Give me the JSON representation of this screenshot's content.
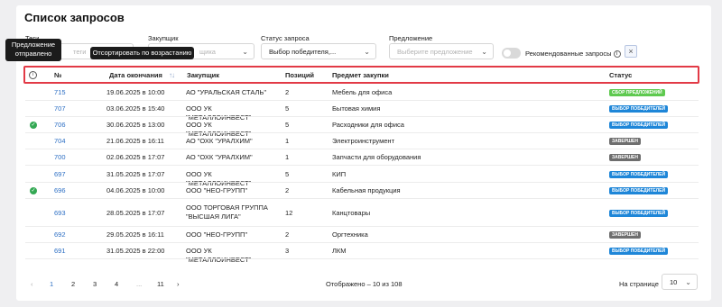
{
  "page": {
    "title": "Список запросов"
  },
  "filters": {
    "tags": {
      "label": "Теги",
      "placeholder": "теги"
    },
    "buyer": {
      "label": "Закупщик",
      "placeholder": "щика"
    },
    "status": {
      "label": "Статус запроса",
      "value": "Выбор победителя,..."
    },
    "offer": {
      "label": "Предложение",
      "placeholder": "Выберите предложение"
    },
    "recommended_label": "Рекомендованные запросы",
    "clear": "×"
  },
  "tooltips": {
    "offer_sent": "Предложение отправлено",
    "sort_asc": "Отсортировать по возрастанию"
  },
  "table": {
    "headers": {
      "num": "№",
      "end_date": "Дата окончания",
      "buyer": "Закупщик",
      "positions": "Позиций",
      "subject": "Предмет закупки",
      "status": "Статус"
    },
    "rows": [
      {
        "offer_sent": false,
        "num": "715",
        "end_date": "19.06.2025 в 10:00",
        "buyer": "АО \"УРАЛЬСКАЯ СТАЛЬ\"",
        "positions": "2",
        "subject": "Мебель для офиса",
        "status": "СБОР ПРЕДЛОЖЕНИЙ",
        "status_color": "#5ec94f"
      },
      {
        "offer_sent": false,
        "num": "707",
        "end_date": "03.06.2025 в 15:40",
        "buyer": "ООО УК \"МЕТАЛЛОИНВЕСТ\"",
        "positions": "5",
        "subject": "Бытовая химия",
        "status": "ВЫБОР ПОБЕДИТЕЛЕЙ",
        "status_color": "#1e86d8"
      },
      {
        "offer_sent": true,
        "num": "706",
        "end_date": "30.06.2025 в 13:00",
        "buyer": "ООО УК \"МЕТАЛЛОИНВЕСТ\"",
        "positions": "5",
        "subject": "Расходники для офиса",
        "status": "ВЫБОР ПОБЕДИТЕЛЕЙ",
        "status_color": "#1e86d8"
      },
      {
        "offer_sent": false,
        "num": "704",
        "end_date": "21.06.2025 в 16:11",
        "buyer": "АО \"ОХК \"УРАЛХИМ\"",
        "positions": "1",
        "subject": "Электроинструмент",
        "status": "ЗАВЕРШЕН",
        "status_color": "#6e6e6e"
      },
      {
        "offer_sent": false,
        "num": "700",
        "end_date": "02.06.2025 в 17:07",
        "buyer": "АО \"ОХК \"УРАЛХИМ\"",
        "positions": "1",
        "subject": "Запчасти для оборудования",
        "status": "ЗАВЕРШЕН",
        "status_color": "#6e6e6e"
      },
      {
        "offer_sent": false,
        "num": "697",
        "end_date": "31.05.2025 в 17:07",
        "buyer": "ООО УК \"МЕТАЛЛОИНВЕСТ\"",
        "positions": "5",
        "subject": "КИП",
        "status": "ВЫБОР ПОБЕДИТЕЛЕЙ",
        "status_color": "#1e86d8"
      },
      {
        "offer_sent": true,
        "num": "696",
        "end_date": "04.06.2025 в 10:00",
        "buyer": "ООО \"НЕО-ГРУПП\"",
        "positions": "2",
        "subject": "Кабельная продукция",
        "status": "ВЫБОР ПОБЕДИТЕЛЕЙ",
        "status_color": "#1e86d8"
      },
      {
        "offer_sent": false,
        "num": "693",
        "end_date": "28.05.2025 в 17:07",
        "buyer": "ООО ТОРГОВАЯ ГРУППА \"ВЫСШАЯ ЛИГА\"",
        "positions": "12",
        "subject": "Канцтовары",
        "status": "ВЫБОР ПОБЕДИТЕЛЕЙ",
        "status_color": "#1e86d8"
      },
      {
        "offer_sent": false,
        "num": "692",
        "end_date": "29.05.2025 в 16:11",
        "buyer": "ООО \"НЕО-ГРУПП\"",
        "positions": "2",
        "subject": "Оргтехника",
        "status": "ЗАВЕРШЕН",
        "status_color": "#6e6e6e"
      },
      {
        "offer_sent": false,
        "num": "691",
        "end_date": "31.05.2025 в 22:00",
        "buyer": "ООО УК \"МЕТАЛЛОИНВЕСТ\"",
        "positions": "3",
        "subject": "ЛКМ",
        "status": "ВЫБОР ПОБЕДИТЕЛЕЙ",
        "status_color": "#1e86d8"
      }
    ]
  },
  "pagination": {
    "prev": "‹",
    "pages": [
      "1",
      "2",
      "3",
      "4",
      "...",
      "11"
    ],
    "next": "›",
    "shown": "Отображено – 10 из 108",
    "per_page_label": "На странице",
    "per_page_value": "10"
  }
}
